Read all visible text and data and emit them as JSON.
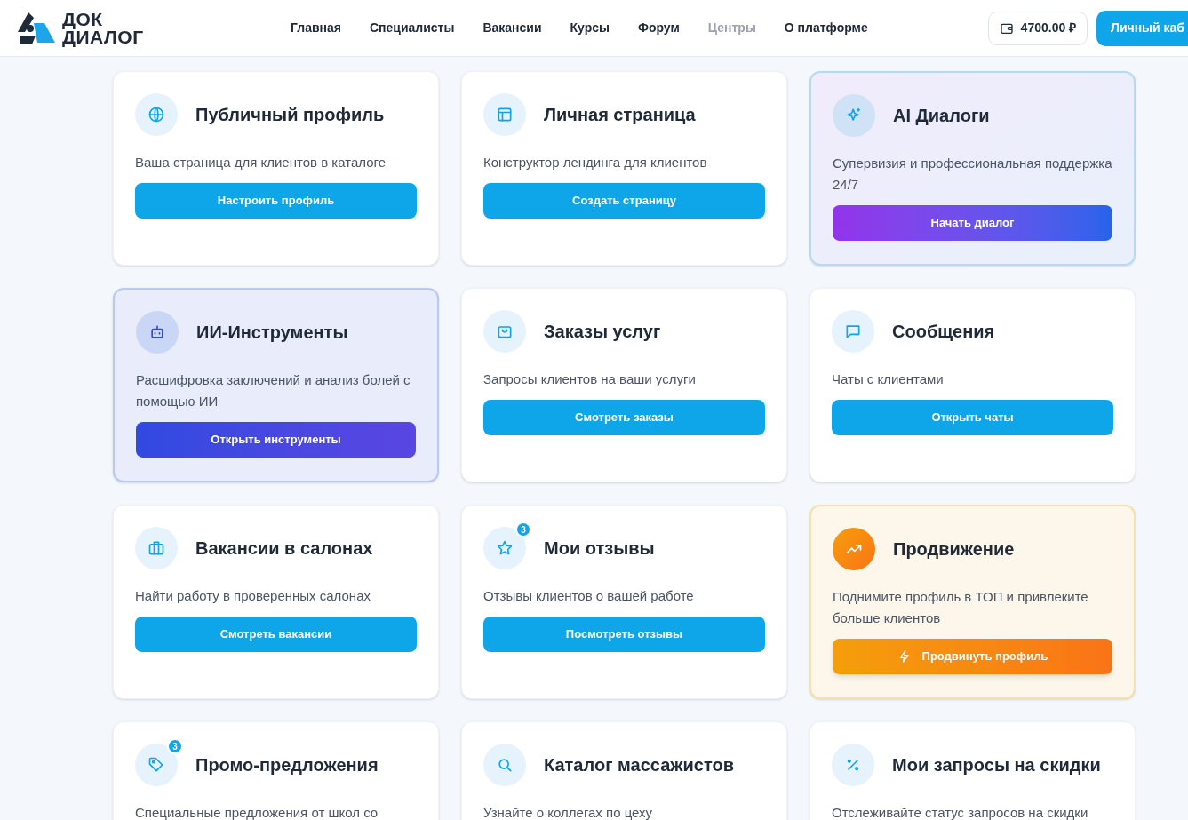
{
  "header": {
    "logo": [
      "ДОК",
      "ДИАЛОГ"
    ],
    "nav": [
      {
        "label": "Главная",
        "disabled": false
      },
      {
        "label": "Специалисты",
        "disabled": false
      },
      {
        "label": "Вакансии",
        "disabled": false
      },
      {
        "label": "Курсы",
        "disabled": false
      },
      {
        "label": "Форум",
        "disabled": false
      },
      {
        "label": "Центры",
        "disabled": true
      },
      {
        "label": "О платформе",
        "disabled": false
      }
    ],
    "balance": "4700.00 ₽",
    "account_button": "Личный каб"
  },
  "cards": [
    {
      "kind": "default",
      "title": "Публичный профиль",
      "description": "Ваша страница для клиентов в каталоге",
      "button": "Настроить профиль"
    },
    {
      "kind": "default",
      "title": "Личная страница",
      "description": "Конструктор лендинга для клиентов",
      "button": "Создать страницу"
    },
    {
      "kind": "ai",
      "title": "AI Диалоги",
      "description": "Супервизия и профессиональная поддержка 24/7",
      "button": "Начать диалог"
    },
    {
      "kind": "tools",
      "title": "ИИ-Инструменты",
      "description": "Расшифровка заключений и анализ болей с помощью ИИ",
      "button": "Открыть инструменты"
    },
    {
      "kind": "default",
      "title": "Заказы услуг",
      "description": "Запросы клиентов на ваши услуги",
      "button": "Смотреть заказы"
    },
    {
      "kind": "default",
      "title": "Сообщения",
      "description": "Чаты с клиентами",
      "button": "Открыть чаты"
    },
    {
      "kind": "default",
      "title": "Вакансии в салонах",
      "description": "Найти работу в проверенных салонах",
      "button": "Смотреть вакансии"
    },
    {
      "kind": "default",
      "badge": "3",
      "title": "Мои отзывы",
      "description": "Отзывы клиентов о вашей работе",
      "button": "Посмотреть отзывы"
    },
    {
      "kind": "promo",
      "title": "Продвижение",
      "description": "Поднимите профиль в ТОП и привлеките больше клиентов",
      "button": "Продвинуть профиль"
    },
    {
      "kind": "default",
      "badge": "3",
      "title": "Промо-предложения",
      "description": "Специальные предложения от школ со"
    },
    {
      "kind": "default",
      "title": "Каталог массажистов",
      "description": "Узнайте о коллегах по цеху"
    },
    {
      "kind": "default",
      "title": "Мои запросы на скидки",
      "description": "Отслеживайте статус запросов на скидки"
    }
  ]
}
